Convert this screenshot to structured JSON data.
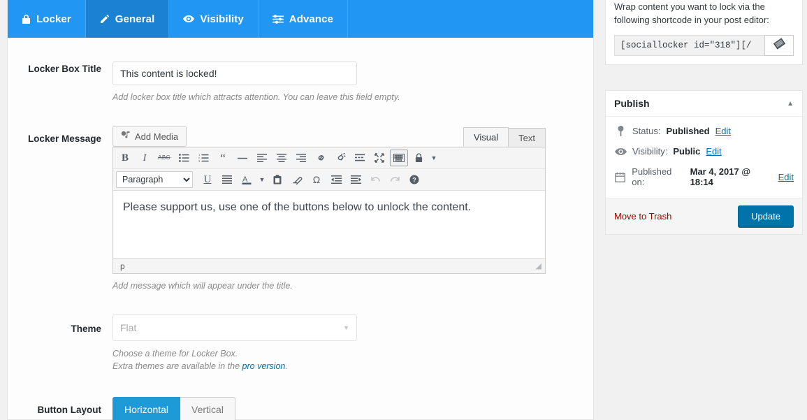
{
  "tabs": [
    {
      "label": "Locker",
      "icon": "lock-icon",
      "active": false
    },
    {
      "label": "General",
      "icon": "pencil-icon",
      "active": true
    },
    {
      "label": "Visibility",
      "icon": "eye-icon",
      "active": false
    },
    {
      "label": "Advance",
      "icon": "sliders-icon",
      "active": false
    }
  ],
  "form": {
    "title_field": {
      "label": "Locker Box Title",
      "value": "This content is locked!",
      "placeholder": "",
      "description": "Add locker box title which attracts attention. You can leave this field empty."
    },
    "message_field": {
      "label": "Locker Message",
      "add_media": "Add Media",
      "visual_tab": "Visual",
      "text_tab": "Text",
      "format_select": "Paragraph",
      "content": "Please support us, use one of the buttons below to unlock the content.",
      "status_path": "p",
      "description": "Add message which will appear under the title."
    },
    "theme_field": {
      "label": "Theme",
      "value": "Flat",
      "description_line1": "Choose a theme for Locker Box.",
      "description_line2_pre": "Extra themes are available in the ",
      "description_link": "pro version",
      "description_line2_post": "."
    },
    "layout_field": {
      "label": "Button Layout",
      "options": [
        "Horizontal",
        "Vertical"
      ],
      "selected": "Horizontal"
    }
  },
  "toolbar_row1": [
    {
      "name": "bold-icon",
      "glyph": "B"
    },
    {
      "name": "italic-icon",
      "glyph": "I"
    },
    {
      "name": "strikethrough-icon",
      "glyph": "ABC"
    },
    {
      "name": "bullet-list-icon",
      "glyph": ""
    },
    {
      "name": "numbered-list-icon",
      "glyph": ""
    },
    {
      "name": "blockquote-icon",
      "glyph": ""
    },
    {
      "name": "horizontal-rule-icon",
      "glyph": ""
    },
    {
      "name": "align-left-icon",
      "glyph": ""
    },
    {
      "name": "align-center-icon",
      "glyph": ""
    },
    {
      "name": "align-right-icon",
      "glyph": ""
    },
    {
      "name": "link-icon",
      "glyph": ""
    },
    {
      "name": "unlink-icon",
      "glyph": ""
    },
    {
      "name": "read-more-icon",
      "glyph": ""
    },
    {
      "name": "fullscreen-icon",
      "glyph": ""
    },
    {
      "name": "toolbar-toggle-icon",
      "glyph": ""
    },
    {
      "name": "lock-icon",
      "glyph": ""
    }
  ],
  "toolbar_row2": [
    {
      "name": "underline-icon",
      "glyph": "U"
    },
    {
      "name": "justify-icon",
      "glyph": ""
    },
    {
      "name": "text-color-icon",
      "glyph": "A"
    },
    {
      "name": "paste-as-text-icon",
      "glyph": ""
    },
    {
      "name": "clear-formatting-icon",
      "glyph": ""
    },
    {
      "name": "special-character-icon",
      "glyph": "Ω"
    },
    {
      "name": "outdent-icon",
      "glyph": ""
    },
    {
      "name": "indent-icon",
      "glyph": ""
    },
    {
      "name": "undo-icon",
      "glyph": ""
    },
    {
      "name": "redo-icon",
      "glyph": ""
    },
    {
      "name": "help-icon",
      "glyph": "?"
    }
  ],
  "sidebar": {
    "shortcode_panel": {
      "note": "Wrap content you want to lock via the following shortcode in your post editor:",
      "shortcode": "[sociallocker id=\"318\"][/",
      "copy_icon": "copy-icon"
    },
    "publish_panel": {
      "title": "Publish",
      "rows": [
        {
          "icon": "pin-icon",
          "label": "Status:",
          "value": "Published",
          "edit": "Edit"
        },
        {
          "icon": "eye-icon",
          "label": "Visibility:",
          "value": "Public",
          "edit": "Edit"
        },
        {
          "icon": "calendar-icon",
          "label": "Published on:",
          "value": "Mar 4, 2017 @ 18:14",
          "edit": "Edit"
        }
      ],
      "trash": "Move to Trash",
      "update": "Update"
    }
  },
  "colors": {
    "tab_bar": "#2196f3",
    "tab_active": "#1b82d3",
    "accent": "#1e9ad6",
    "wp_blue": "#0073aa",
    "trash_red": "#a00000"
  }
}
